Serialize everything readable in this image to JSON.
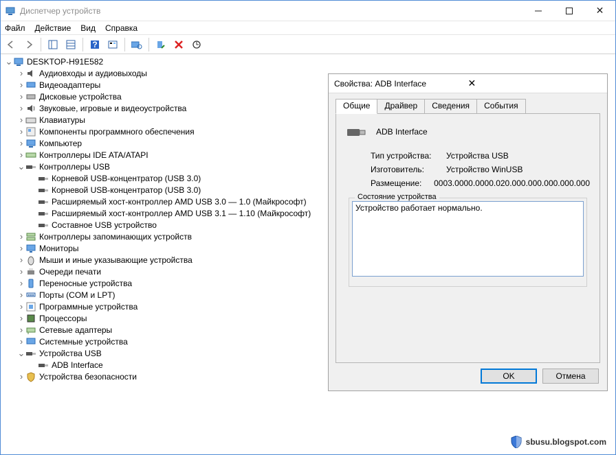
{
  "window": {
    "title": "Диспетчер устройств"
  },
  "menu": {
    "file": "Файл",
    "action": "Действие",
    "view": "Вид",
    "help": "Справка"
  },
  "tree": {
    "root": "DESKTOP-H91E582",
    "nodes": [
      "Аудиовходы и аудиовыходы",
      "Видеоадаптеры",
      "Дисковые устройства",
      "Звуковые, игровые и видеоустройства",
      "Клавиатуры",
      "Компоненты программного обеспечения",
      "Компьютер",
      "Контроллеры IDE ATA/ATAPI"
    ],
    "usb_ctrl": "Контроллеры USB",
    "usb_children": [
      "Корневой USB-концентратор (USB 3.0)",
      "Корневой USB-концентратор (USB 3.0)",
      "Расширяемый хост-контроллер AMD USB 3.0 — 1.0 (Майкрософт)",
      "Расширяемый хост-контроллер AMD USB 3.1 — 1.10 (Майкрософт)",
      "Составное USB устройство"
    ],
    "after": [
      "Контроллеры запоминающих устройств",
      "Мониторы",
      "Мыши и иные указывающие устройства",
      "Очереди печати",
      "Переносные устройства",
      "Порты (COM и LPT)",
      "Программные устройства",
      "Процессоры",
      "Сетевые адаптеры",
      "Системные устройства"
    ],
    "usb_dev": "Устройства USB",
    "usb_dev_children": [
      "ADB Interface"
    ],
    "last": "Устройства безопасности"
  },
  "dialog": {
    "title": "Свойства: ADB Interface",
    "tabs": [
      "Общие",
      "Драйвер",
      "Сведения",
      "События"
    ],
    "device_name": "ADB Interface",
    "rows": {
      "type_k": "Тип устройства:",
      "type_v": "Устройства USB",
      "mfr_k": "Изготовитель:",
      "mfr_v": "Устройство WinUSB",
      "loc_k": "Размещение:",
      "loc_v": "0003.0000.0000.020.000.000.000.000.000"
    },
    "status_legend": "Состояние устройства",
    "status_text": "Устройство работает нормально.",
    "ok": "OK",
    "cancel": "Отмена"
  },
  "watermark": "sbusu.blogspot.com"
}
